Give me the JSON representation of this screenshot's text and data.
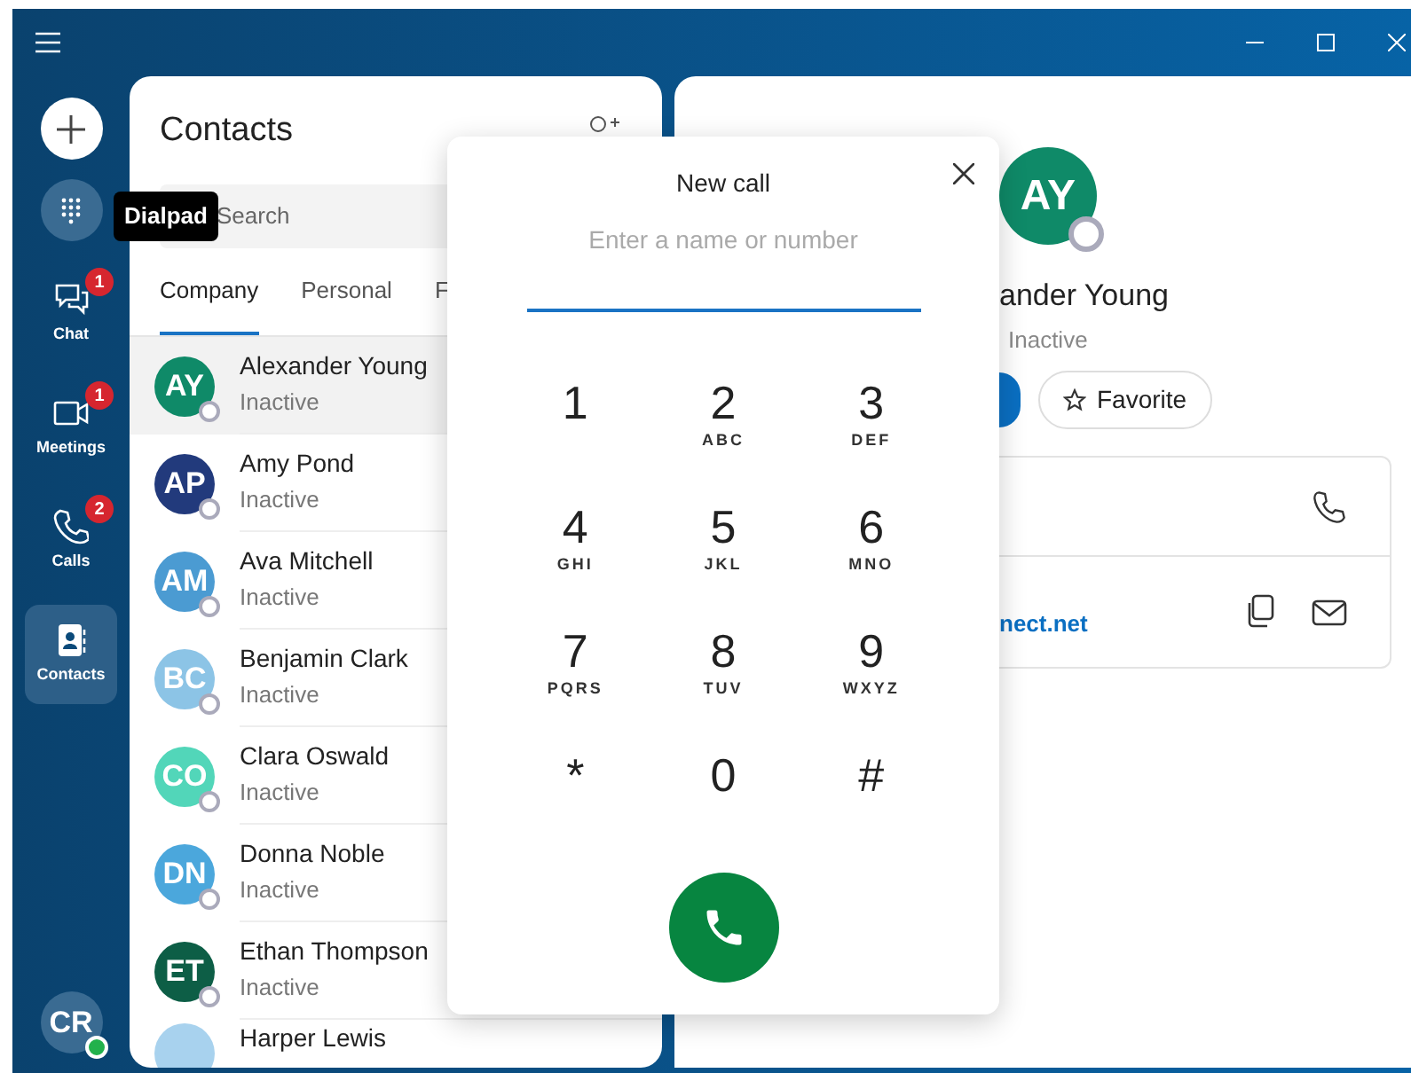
{
  "sidebar": {
    "actions": [
      {
        "kind": "new"
      },
      {
        "kind": "dialpad",
        "tooltip": "Dialpad"
      }
    ],
    "nav": [
      {
        "kind": "chat",
        "label": "Chat",
        "badge": "1",
        "selected": false
      },
      {
        "kind": "video",
        "label": "Meetings",
        "badge": "1",
        "selected": false
      },
      {
        "kind": "phone",
        "label": "Calls",
        "badge": "2",
        "selected": false
      },
      {
        "kind": "contacts",
        "label": "Contacts",
        "selected": true
      }
    ],
    "user": {
      "initials": "CR",
      "online": true
    }
  },
  "contacts": {
    "title": "Contacts",
    "search": {
      "placeholder": "Search"
    },
    "tabs": [
      {
        "label": "Company",
        "selected": true
      },
      {
        "label": "Personal",
        "selected": false
      },
      {
        "label": "F",
        "selected": false
      }
    ],
    "rows": [
      {
        "initials": "AY",
        "name": "Alexander Young",
        "status": "Inactive",
        "color": "#0f8a68",
        "selected": true
      },
      {
        "initials": "AP",
        "name": "Amy Pond",
        "status": "Inactive",
        "color": "#223a7c",
        "selected": false
      },
      {
        "initials": "AM",
        "name": "Ava Mitchell",
        "status": "Inactive",
        "color": "#4b9bd2",
        "selected": false
      },
      {
        "initials": "BC",
        "name": "Benjamin Clark",
        "status": "Inactive",
        "color": "#8cc4e6",
        "selected": false
      },
      {
        "initials": "CO",
        "name": "Clara Oswald",
        "status": "Inactive",
        "color": "#52d6b9",
        "selected": false
      },
      {
        "initials": "DN",
        "name": "Donna Noble",
        "status": "Inactive",
        "color": "#4ba7dc",
        "selected": false
      },
      {
        "initials": "ET",
        "name": "Ethan Thompson",
        "status": "Inactive",
        "color": "#0d5e46",
        "selected": false
      },
      {
        "name": "Harper Lewis",
        "color": "#a8d2ee",
        "selected": false
      }
    ]
  },
  "detail": {
    "initials": "AY",
    "color": "#0f8a68",
    "name": "ander Young",
    "status": "Inactive",
    "favorite": "Favorite",
    "email": "nect.net"
  },
  "dialog": {
    "title": "New call",
    "placeholder": "Enter a name or number",
    "keys": [
      {
        "digit": "1"
      },
      {
        "digit": "2",
        "letters": "ABC"
      },
      {
        "digit": "3",
        "letters": "DEF"
      },
      {
        "digit": "4",
        "letters": "GHI"
      },
      {
        "digit": "5",
        "letters": "JKL"
      },
      {
        "digit": "6",
        "letters": "MNO"
      },
      {
        "digit": "7",
        "letters": "PQRS"
      },
      {
        "digit": "8",
        "letters": "TUV"
      },
      {
        "digit": "9",
        "letters": "WXYZ"
      },
      {
        "digit": "*"
      },
      {
        "digit": "0"
      },
      {
        "digit": "#"
      }
    ]
  }
}
